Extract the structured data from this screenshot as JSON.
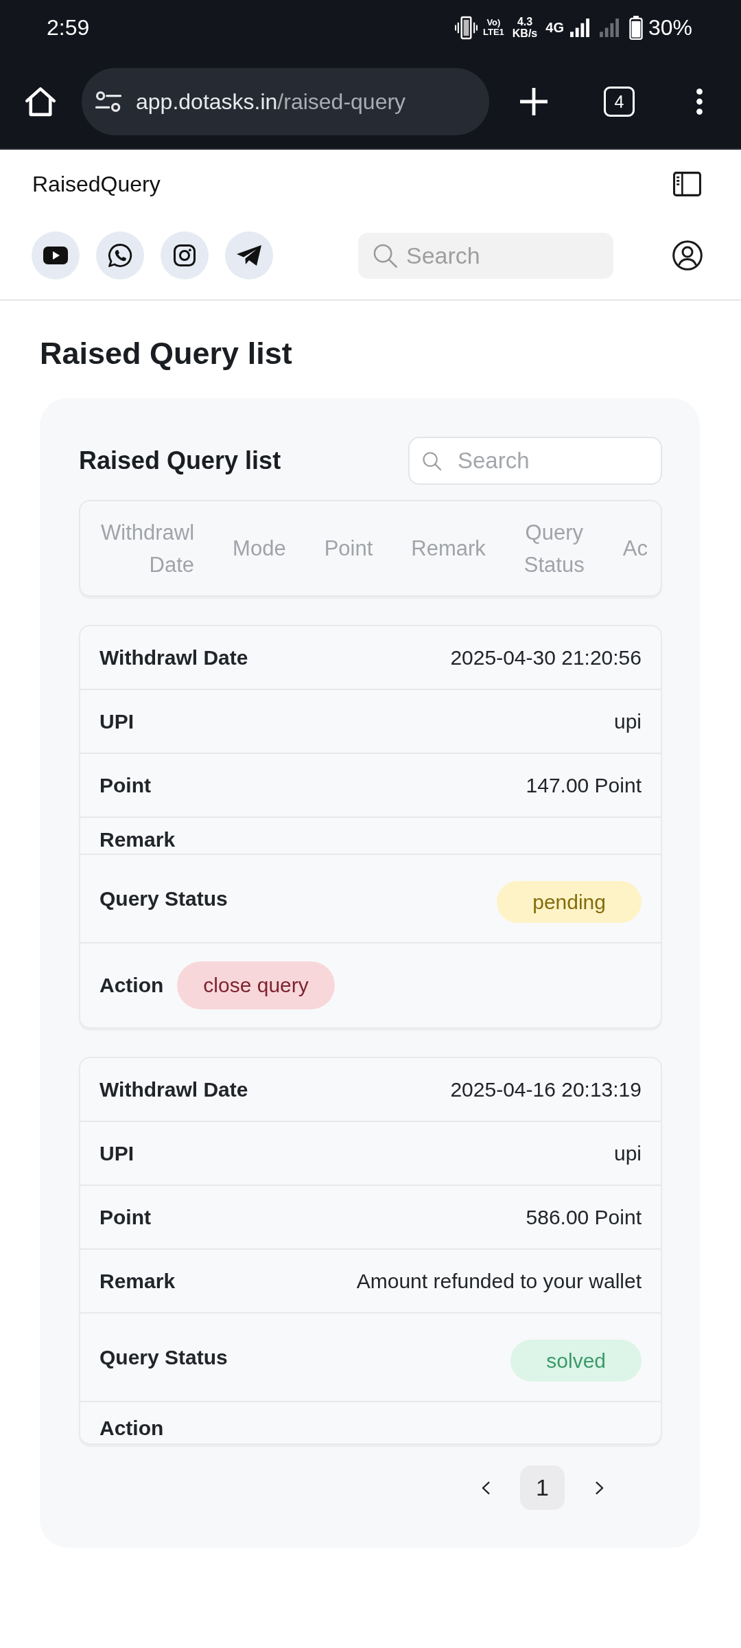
{
  "status_bar": {
    "time": "2:59",
    "volte_top": "Vo)",
    "volte_bottom": "LTE1",
    "speed_value": "4.3",
    "speed_unit": "KB/s",
    "network": "4G",
    "battery": "30%"
  },
  "browser": {
    "url_host": "app.dotasks.in",
    "url_path": "/raised-query",
    "tab_count": "4"
  },
  "header": {
    "app_title": "RaisedQuery",
    "search": {
      "placeholder": "Search"
    }
  },
  "page_title": "Raised Query list",
  "panel": {
    "title": "Raised Query list",
    "search": {
      "placeholder": "Search"
    },
    "table": {
      "columns": [
        "Withdrawl Date",
        "Mode",
        "Point",
        "Remark",
        "Query Status",
        "Ac"
      ]
    },
    "records": [
      {
        "rows": [
          {
            "kind": "text",
            "label": "Withdrawl Date",
            "value": "2025-04-30 21:20:56"
          },
          {
            "kind": "text",
            "label": "UPI",
            "value": "upi"
          },
          {
            "kind": "text",
            "label": "Point",
            "value": "147.00 Point"
          },
          {
            "kind": "text",
            "label": "Remark"
          },
          {
            "kind": "badge",
            "label": "Query Status",
            "value": "pending",
            "color": "#fef3c7"
          },
          {
            "kind": "action",
            "label": "Action",
            "button": "close query"
          }
        ]
      },
      {
        "rows": [
          {
            "kind": "text",
            "label": "Withdrawl Date",
            "value": "2025-04-16 20:13:19"
          },
          {
            "kind": "text",
            "label": "UPI",
            "value": "upi"
          },
          {
            "kind": "text",
            "label": "Point",
            "value": "586.00 Point"
          },
          {
            "kind": "text",
            "label": "Remark",
            "value": "Amount refunded to your wallet"
          },
          {
            "kind": "badge",
            "label": "Query Status",
            "value": "solved",
            "color": "#dcf5e8"
          },
          {
            "kind": "action",
            "label": "Action"
          }
        ]
      }
    ],
    "pagination": {
      "pages": [
        {
          "label": "1",
          "selected": true
        }
      ]
    }
  }
}
